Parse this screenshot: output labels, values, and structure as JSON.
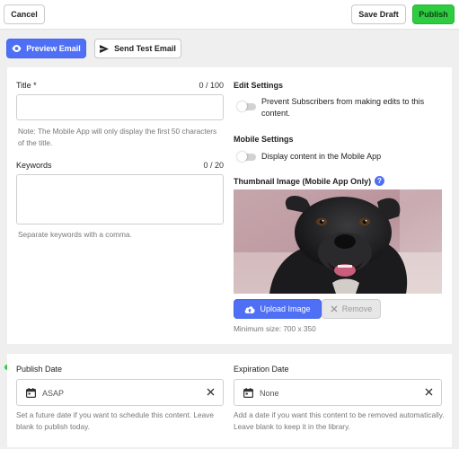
{
  "toolbar": {
    "cancel_label": "Cancel",
    "save_draft_label": "Save Draft",
    "publish_label": "Publish"
  },
  "actions": {
    "preview_email_label": "Preview Email",
    "send_test_email_label": "Send Test Email"
  },
  "title_field": {
    "label": "Title *",
    "counter": "0 / 100",
    "value": "",
    "help": "Note: The Mobile App will only display the first 50 characters of the title."
  },
  "keywords_field": {
    "label": "Keywords",
    "counter": "0 / 20",
    "value": "",
    "help": "Separate keywords with a comma."
  },
  "edit_settings": {
    "heading": "Edit Settings",
    "toggle_label": "Prevent Subscribers from making edits to this content.",
    "enabled": false
  },
  "mobile_settings": {
    "heading": "Mobile Settings",
    "toggle_label": "Display content in the Mobile App",
    "enabled": false
  },
  "thumbnail": {
    "heading": "Thumbnail Image (Mobile App Only)",
    "upload_label": "Upload Image",
    "remove_label": "Remove",
    "min_size_text": "Minimum size: 700 x 350"
  },
  "publish_date": {
    "label": "Publish Date",
    "value": "ASAP",
    "help": "Set a future date if you want to schedule this content. Leave blank to publish today."
  },
  "expiration_date": {
    "label": "Expiration Date",
    "value": "None",
    "help": "Add a date if you want this content to be removed automatically. Leave blank to keep it in the library."
  },
  "colors": {
    "accent_blue": "#4f70f5",
    "publish_green": "#2ecc40",
    "indicator_green": "#2ecc40"
  },
  "icons": [
    "eye-icon",
    "send-icon",
    "help-icon",
    "cloud-upload-icon",
    "close-icon",
    "calendar-icon",
    "clear-icon"
  ]
}
